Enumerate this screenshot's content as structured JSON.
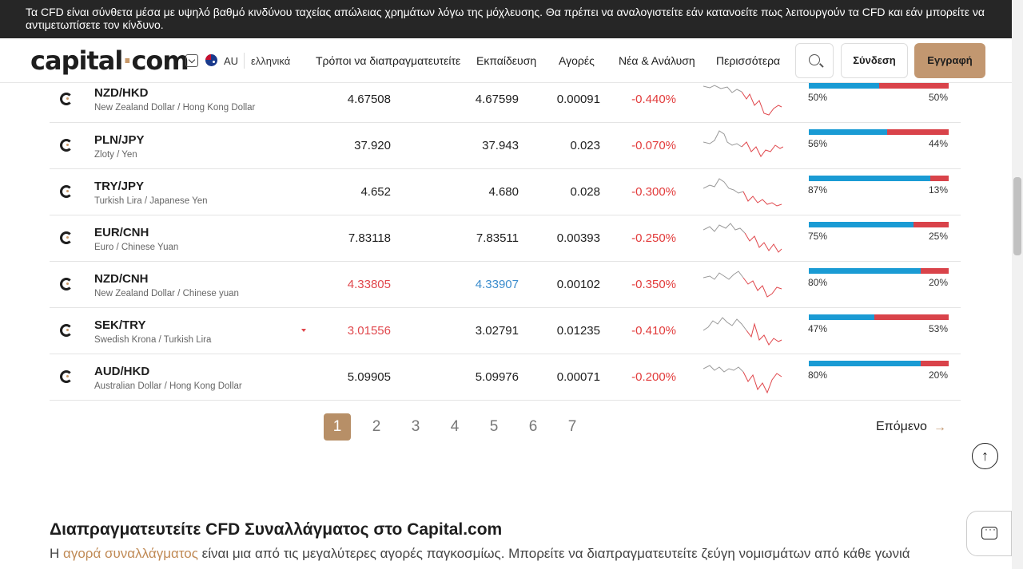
{
  "banner": {
    "text": "Τα CFD είναι σύνθετα μέσα με υψηλό βαθμό κινδύνου ταχείας απώλειας χρημάτων λόγω της μόχλευσης. Θα πρέπει να αναλογιστείτε εάν κατανοείτε πως λειτουργούν τα CFD και εάν μπορείτε να αντιμετωπίσετε τον κίνδυνο."
  },
  "nav": {
    "logo_main": "capital",
    "logo_dot": "·",
    "logo_tld": "com",
    "region": "AU",
    "language": "ελληνικά",
    "links": [
      "Τρόποι να διαπραγματευτείτε",
      "Εκπαίδευση",
      "Αγορές",
      "Νέα & Ανάλυση",
      "Περισσότερα"
    ],
    "login": "Σύνδεση",
    "signup": "Εγγραφή"
  },
  "table": {
    "rows": [
      {
        "symbol": "NZD/HKD",
        "name": "New Zealand Dollar / Hong Kong Dollar",
        "sell": "4.67508",
        "buy": "4.67599",
        "spread": "0.00091",
        "change": "-0.440%",
        "buy_pct": "50%",
        "sell_pct": "50%",
        "buy_share": 0.5
      },
      {
        "symbol": "PLN/JPY",
        "name": "Zloty / Yen",
        "sell": "37.920",
        "buy": "37.943",
        "spread": "0.023",
        "change": "-0.070%",
        "buy_pct": "56%",
        "sell_pct": "44%",
        "buy_share": 0.56
      },
      {
        "symbol": "TRY/JPY",
        "name": "Turkish Lira / Japanese Yen",
        "sell": "4.652",
        "buy": "4.680",
        "spread": "0.028",
        "change": "-0.300%",
        "buy_pct": "87%",
        "sell_pct": "13%",
        "buy_share": 0.87
      },
      {
        "symbol": "EUR/CNH",
        "name": "Euro / Chinese Yuan",
        "sell": "7.83118",
        "buy": "7.83511",
        "spread": "0.00393",
        "change": "-0.250%",
        "buy_pct": "75%",
        "sell_pct": "25%",
        "buy_share": 0.75
      },
      {
        "symbol": "NZD/CNH",
        "name": "New Zealand Dollar / Chinese yuan",
        "sell": "4.33805",
        "buy": "4.33907",
        "spread": "0.00102",
        "change": "-0.350%",
        "buy_pct": "80%",
        "sell_pct": "20%",
        "buy_share": 0.8
      },
      {
        "symbol": "SEK/TRY",
        "name": "Swedish Krona / Turkish Lira",
        "sell": "3.01556",
        "buy": "3.02791",
        "spread": "0.01235",
        "change": "-0.410%",
        "buy_pct": "47%",
        "sell_pct": "53%",
        "buy_share": 0.47
      },
      {
        "symbol": "AUD/HKD",
        "name": "Australian Dollar / Hong Kong Dollar",
        "sell": "5.09905",
        "buy": "5.09976",
        "spread": "0.00071",
        "change": "-0.200%",
        "buy_pct": "80%",
        "sell_pct": "20%",
        "buy_share": 0.8
      }
    ]
  },
  "pagination": {
    "pages": [
      "1",
      "2",
      "3",
      "4",
      "5",
      "6",
      "7"
    ],
    "current": "1",
    "next": "Επόμενο",
    "next_arrow": "→"
  },
  "scroll_top_icon": "↑",
  "section": {
    "heading": "Διαπραγματευτείτε CFD Συναλλάγματος στο Capital.com",
    "text_prefix": "Η ",
    "text_link": "αγορά συναλλάγματος",
    "text_rest": " είναι μια από τις μεγαλύτερες αγορές παγκοσμίως. Μπορείτε να διαπραγματευτείτε ζεύγη νομισμάτων από κάθε γωνιά"
  },
  "colors": {
    "accent": "#c29770",
    "negative": "#e0474c",
    "positive_bar": "#1a9bd4",
    "banner_bg": "#262626"
  }
}
